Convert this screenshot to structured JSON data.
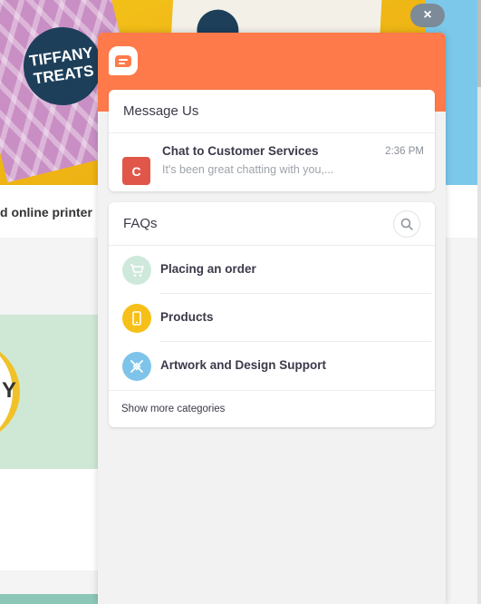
{
  "background": {
    "hero_text_line1": "TIFFANY",
    "hero_text_line2": "TREATS",
    "caption": "d online printer",
    "tile_text": "Y"
  },
  "widget": {
    "close_icon": "×",
    "brand_icon": "chat-bubble-icon",
    "accent_color": "#ff7a4a",
    "messages": {
      "title": "Message Us",
      "conversation": {
        "avatar_letter": "C",
        "name": "Chat to Customer Services",
        "preview": "It's been great chatting with you,...",
        "time": "2:36 PM"
      }
    },
    "faqs": {
      "title": "FAQs",
      "search_icon": "search-icon",
      "categories": [
        {
          "label": "Placing an order",
          "icon": "shopping-cart-icon",
          "color": "#cfe8dc"
        },
        {
          "label": "Products",
          "icon": "phone-icon",
          "color": "#f7c018"
        },
        {
          "label": "Artwork and Design Support",
          "icon": "design-tools-icon",
          "color": "#7ec4ea"
        }
      ],
      "show_more": "Show more categories"
    }
  }
}
